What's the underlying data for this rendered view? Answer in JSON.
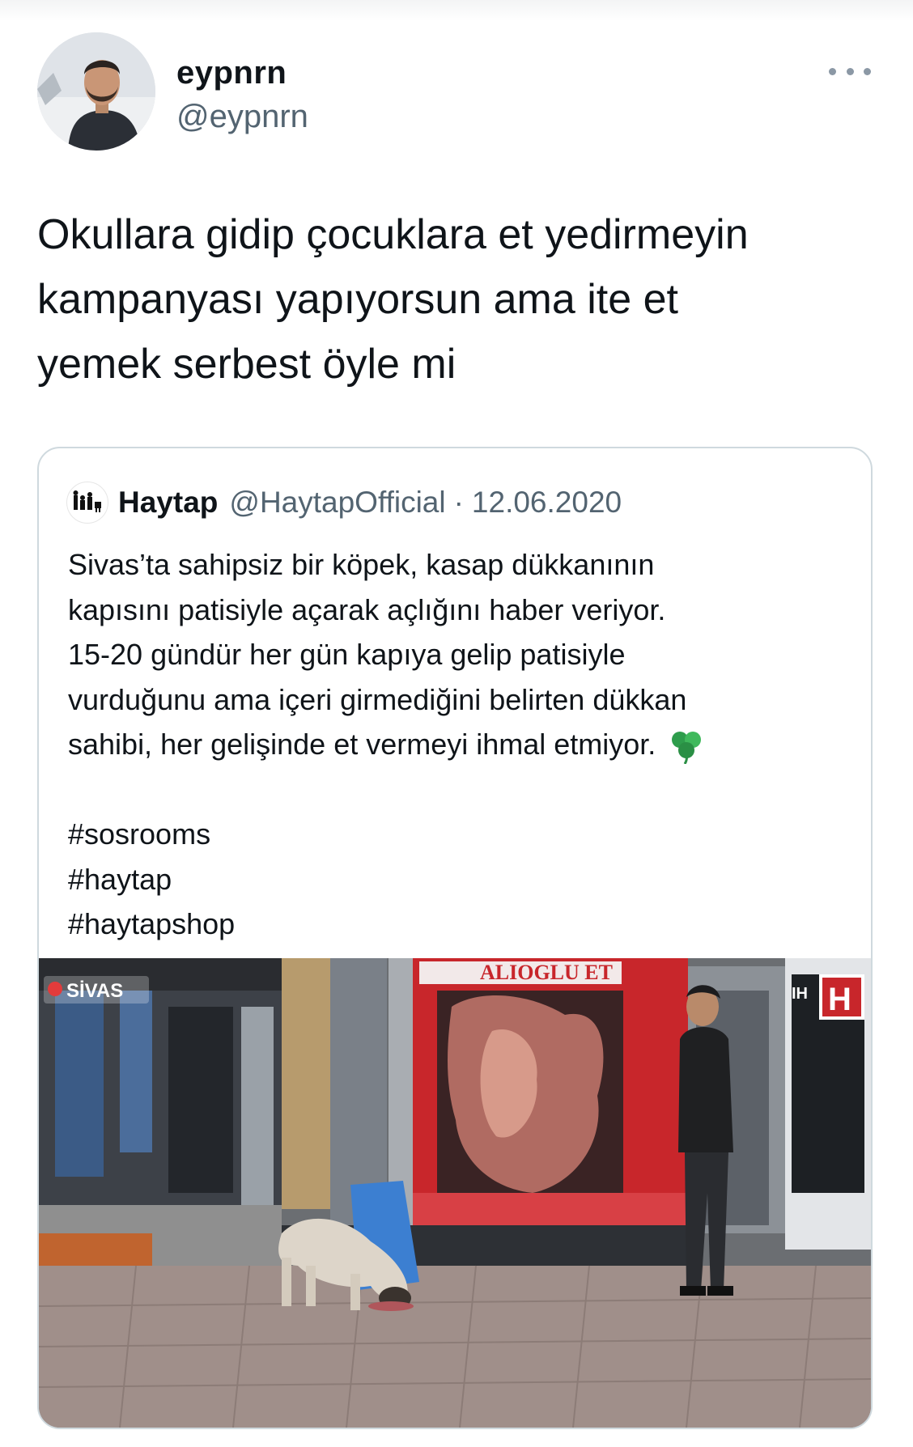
{
  "tweet": {
    "author": {
      "display_name": "eypnrn",
      "handle": "@eypnrn",
      "avatar_icon": "profile-photo"
    },
    "more_icon": "more-horizontal-icon",
    "text_lines": [
      "Okullara gidip çocuklara et yedirmeyin",
      "kampanyası yapıyorsun ama ite et",
      "yemek serbest öyle mi"
    ]
  },
  "quoted": {
    "author": {
      "display_name": "Haytap",
      "handle": "@HaytapOfficial",
      "separator": "·",
      "date": "12.06.2020",
      "avatar_icon": "haytap-logo"
    },
    "text_lines": [
      "Sivas’ta sahipsiz bir köpek, kasap dükkanının",
      "kapısını patisiyle açarak açlığını haber veriyor.",
      "15-20 gündür her gün kapıya gelip patisiyle",
      "vurduğunu ama içeri girmediğini belirten dükkan",
      "sahibi, her gelişinde et vermeyi ihmal etmiyor."
    ],
    "emoji_icon": "shamrock-emoji",
    "hashtags": [
      "#sosrooms",
      "#haytap",
      "#haytapshop"
    ],
    "media": {
      "shop_sign": "ALİOĞLU ET",
      "location_tag": "SİVAS",
      "channel_logo": "IHA / H",
      "colors": {
        "shop_frame": "#c8262b",
        "bag": "#3c7fd1"
      }
    }
  }
}
